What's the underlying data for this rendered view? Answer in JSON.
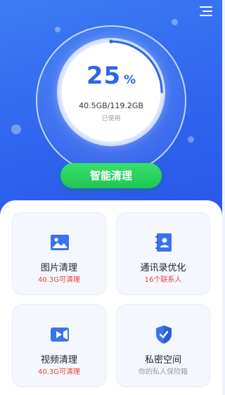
{
  "header": {
    "menu_icon": "hamburger-menu-icon"
  },
  "storage": {
    "percent": "25",
    "percent_symbol": "%",
    "progress_fraction": 0.25,
    "usage_text": "40.5GB/119.2GB",
    "used_label": "已使用"
  },
  "primary_action": {
    "label": "智能清理"
  },
  "cards": [
    {
      "title": "图片清理",
      "subtitle": "40.3G可清理",
      "icon": "image-icon"
    },
    {
      "title": "通讯录优化",
      "subtitle": "16个联系人",
      "icon": "contacts-book-icon"
    },
    {
      "title": "视频清理",
      "subtitle": "40.3G可清理",
      "icon": "video-camera-icon"
    },
    {
      "title": "私密空间",
      "subtitle": "你的私人保险箱",
      "icon": "shield-icon"
    }
  ],
  "colors": {
    "brand_blue": "#2f64ee",
    "action_green": "#22c95a",
    "highlight_red": "#e8453c",
    "muted_gray": "#999999"
  }
}
